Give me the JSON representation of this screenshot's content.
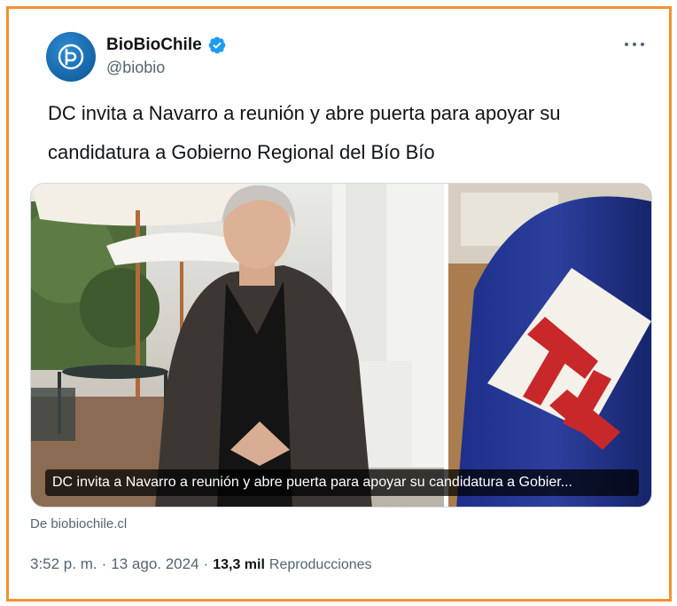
{
  "account": {
    "display_name": "BioBioChile",
    "handle": "@biobio",
    "avatar_icon": "biobio-logo",
    "verified_icon": "verified-badge-icon",
    "verified_color": "#1d9bf0"
  },
  "tweet": {
    "text_line1": "DC invita a Navarro a reunión y abre puerta para apoyar su",
    "text_line2": "candidatura a Gobierno Regional del Bío Bío"
  },
  "card": {
    "caption": "DC invita a Navarro a reunión y abre puerta para apoyar su candidatura a Gobier...",
    "source": "De biobiochile.cl"
  },
  "meta": {
    "time": "3:52 p. m.",
    "separator": "·",
    "date": "13 ago. 2024",
    "views_count": "13,3 mil",
    "views_label": "Reproducciones"
  },
  "colors": {
    "frame_border": "#f4912f",
    "secondary_text": "#536471",
    "primary_text": "#0f1419"
  }
}
